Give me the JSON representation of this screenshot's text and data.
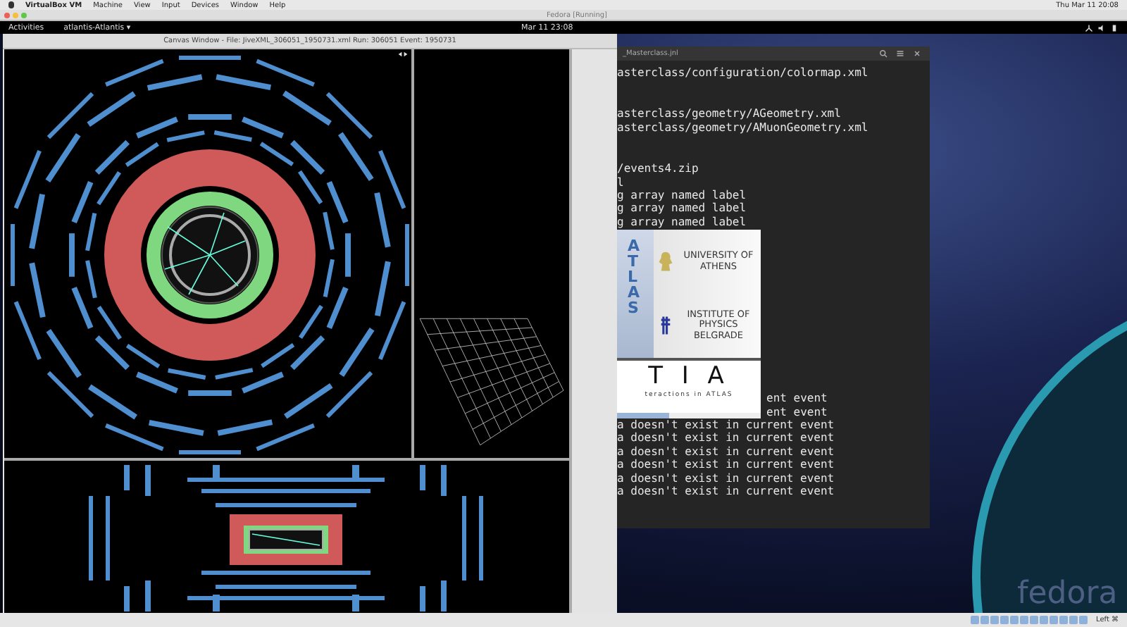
{
  "host_menu_bar": {
    "items": [
      "VirtualBox VM",
      "Machine",
      "View",
      "Input",
      "Devices",
      "Window",
      "Help"
    ],
    "clock": "Thu Mar 11 20:08"
  },
  "vm_window": {
    "title": "Fedora [Running]"
  },
  "top_bar": {
    "activities": "Activities",
    "app_menu": "atlantis-Atlantis ▾",
    "clock": "Mar 11 23:08"
  },
  "canvas_window": {
    "title": "Canvas Window - File: JiveXML_306051_1950731.xml  Run: 306051  Event: 1950731"
  },
  "terminal": {
    "title": "_Masterclass.jnl",
    "blocks": [
      {
        "lines": [
          {
            "text": "asterclass/configuration/colormap.xml",
            "kind": "full"
          }
        ]
      },
      {
        "lines": [
          {
            "text": "asterclass/geometry/AGeometry.xml",
            "kind": "full"
          },
          {
            "text": "asterclass/geometry/AMuonGeometry.xml",
            "kind": "full"
          }
        ]
      },
      {
        "lines": [
          {
            "text": "/events4.zip",
            "kind": "full"
          },
          {
            "text": "l",
            "kind": "full"
          },
          {
            "text": "g array named label",
            "kind": "full"
          },
          {
            "text": "g array named label",
            "kind": "full"
          },
          {
            "text": "g array named label",
            "kind": "full"
          }
        ]
      },
      {
        "lines": [
          {
            "text": "ent event",
            "kind": "covered"
          },
          {
            "text": "ent event",
            "kind": "covered"
          },
          {
            "text": "a doesn't exist in current event",
            "kind": "full"
          },
          {
            "text": "a doesn't exist in current event",
            "kind": "full"
          },
          {
            "text": "a doesn't exist in current event",
            "kind": "full"
          },
          {
            "text": "a doesn't exist in current event",
            "kind": "full"
          },
          {
            "text": "a doesn't exist in current event",
            "kind": "full"
          },
          {
            "text": "a doesn't exist in current event",
            "kind": "full"
          }
        ]
      }
    ]
  },
  "splash": {
    "vertical_logo": "ATLAS",
    "university": "UNIVERSITY OF ATHENS",
    "institute": "INSTITUTE OF PHYSICS BELGRADE",
    "name": "T I A",
    "tagline": "teractions in ATLAS",
    "progress": {
      "level": 0.36
    }
  },
  "wallpaper": {
    "logo": "fedora"
  },
  "host_status": {
    "key": "Left ⌘"
  }
}
